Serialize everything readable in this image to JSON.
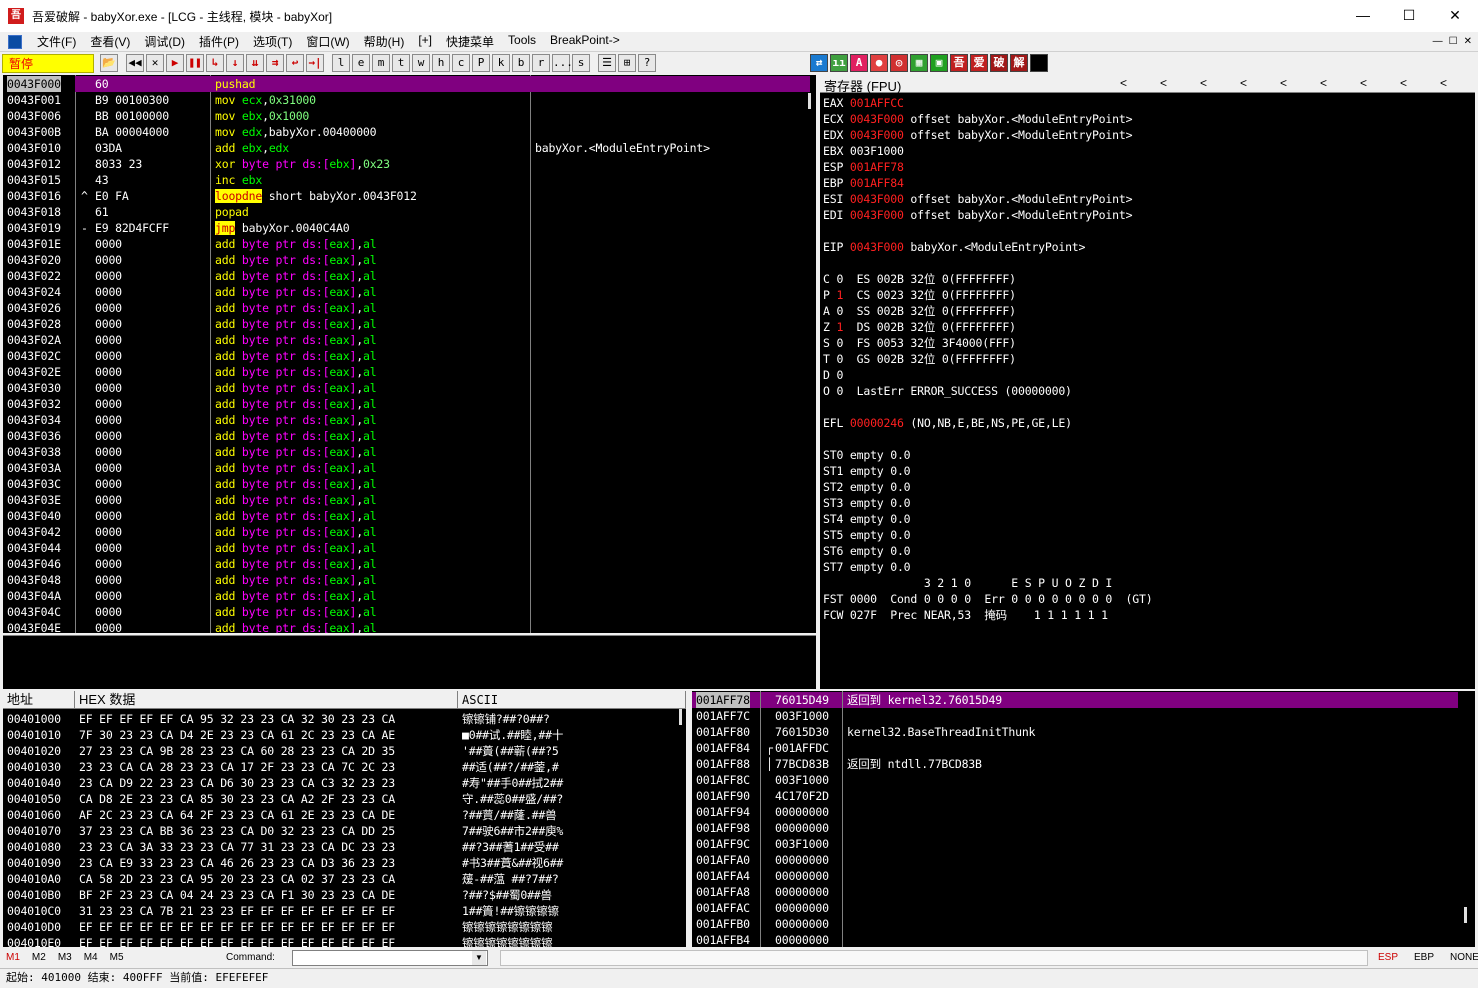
{
  "window": {
    "title": "吾爱破解 - babyXor.exe - [LCG - 主线程, 模块 - babyXor]",
    "app_icon": "吾",
    "minimize": "—",
    "maximize": "☐",
    "close": "✕"
  },
  "menu": [
    "文件(F)",
    "查看(V)",
    "调试(D)",
    "插件(P)",
    "选项(T)",
    "窗口(W)",
    "帮助(H)",
    "[+]",
    "快捷菜单",
    "Tools",
    "BreakPoint->"
  ],
  "mdi_buttons": [
    "—",
    "☐",
    "✕"
  ],
  "toolbar": {
    "status": "暂停",
    "buttons": [
      "📂",
      "◀◀",
      "✕",
      "▶",
      "❚❚",
      "↳",
      "↓",
      "⇊",
      "⇉",
      "↩",
      "→|",
      "l",
      "e",
      "m",
      "t",
      "w",
      "h",
      "c",
      "P",
      "k",
      "b",
      "r",
      "...",
      "s",
      "☰",
      "⊞",
      "?"
    ],
    "right_buttons": [
      {
        "t": "⇄",
        "c": "#1a7ad0"
      },
      {
        "t": "ıı",
        "c": "#40a040"
      },
      {
        "t": "A",
        "c": "#e02060"
      },
      {
        "t": "●",
        "c": "#e04040"
      },
      {
        "t": "◎",
        "c": "#d03030"
      },
      {
        "t": "▦",
        "c": "#30a030"
      },
      {
        "t": "▣",
        "c": "#20a020"
      },
      {
        "t": "吾",
        "c": "#c02020"
      },
      {
        "t": "爱",
        "c": "#c02020"
      },
      {
        "t": "破",
        "c": "#a01818"
      },
      {
        "t": "解",
        "c": "#a01818"
      },
      {
        "t": "",
        "c": "#000000"
      }
    ]
  },
  "disasm": [
    {
      "a": "0043F000",
      "m": "",
      "h": "60",
      "i": [
        [
          "pushad",
          "w"
        ]
      ],
      "c": "",
      "sel": true
    },
    {
      "a": "0043F001",
      "m": "",
      "h": "B9 00100300",
      "i": [
        [
          "mov ",
          "y"
        ],
        [
          "ecx",
          "g"
        ],
        [
          ",",
          "w"
        ],
        [
          "0x31000",
          "n"
        ]
      ],
      "c": ""
    },
    {
      "a": "0043F006",
      "m": "",
      "h": "BB 00100000",
      "i": [
        [
          "mov ",
          "y"
        ],
        [
          "ebx",
          "g"
        ],
        [
          ",",
          "w"
        ],
        [
          "0x1000",
          "n"
        ]
      ],
      "c": ""
    },
    {
      "a": "0043F00B",
      "m": "",
      "h": "BA 00004000",
      "i": [
        [
          "mov ",
          "y"
        ],
        [
          "edx",
          "g"
        ],
        [
          ",babyXor.00400000",
          "w"
        ]
      ],
      "c": ""
    },
    {
      "a": "0043F010",
      "m": "",
      "h": "03DA",
      "i": [
        [
          "add ",
          "y"
        ],
        [
          "ebx",
          "g"
        ],
        [
          ",",
          "w"
        ],
        [
          "edx",
          "g"
        ]
      ],
      "c": "babyXor.<ModuleEntryPoint>"
    },
    {
      "a": "0043F012",
      "m": "",
      "h": "8033 23",
      "i": [
        [
          "xor ",
          "y"
        ],
        [
          "byte ptr ",
          "m"
        ],
        [
          "ds:[",
          "m"
        ],
        [
          "ebx",
          "g"
        ],
        [
          "]",
          "m"
        ],
        [
          ",",
          "w"
        ],
        [
          "0x23",
          "n"
        ]
      ],
      "c": ""
    },
    {
      "a": "0043F015",
      "m": "",
      "h": "43",
      "i": [
        [
          "inc ",
          "y"
        ],
        [
          "ebx",
          "g"
        ]
      ],
      "c": ""
    },
    {
      "a": "0043F016",
      "m": "^",
      "h": "E0 FA",
      "i": [
        [
          "loopdne",
          "hl"
        ],
        [
          " short babyXor.0043F012",
          "w"
        ]
      ],
      "c": ""
    },
    {
      "a": "0043F018",
      "m": "",
      "h": "61",
      "i": [
        [
          "popad",
          "y"
        ]
      ],
      "c": ""
    },
    {
      "a": "0043F019",
      "m": "-",
      "h": "E9 82D4FCFF",
      "i": [
        [
          "jmp",
          "hl"
        ],
        [
          " babyXor.0040C4A0",
          "w"
        ]
      ],
      "c": ""
    },
    {
      "a": "0043F01E",
      "m": "",
      "h": "0000",
      "i": "std",
      "c": ""
    },
    {
      "a": "0043F020",
      "m": "",
      "h": "0000",
      "i": "std",
      "c": ""
    },
    {
      "a": "0043F022",
      "m": "",
      "h": "0000",
      "i": "std",
      "c": ""
    },
    {
      "a": "0043F024",
      "m": "",
      "h": "0000",
      "i": "std",
      "c": ""
    },
    {
      "a": "0043F026",
      "m": "",
      "h": "0000",
      "i": "std",
      "c": ""
    },
    {
      "a": "0043F028",
      "m": "",
      "h": "0000",
      "i": "std",
      "c": ""
    },
    {
      "a": "0043F02A",
      "m": "",
      "h": "0000",
      "i": "std",
      "c": ""
    },
    {
      "a": "0043F02C",
      "m": "",
      "h": "0000",
      "i": "std",
      "c": ""
    },
    {
      "a": "0043F02E",
      "m": "",
      "h": "0000",
      "i": "std",
      "c": ""
    },
    {
      "a": "0043F030",
      "m": "",
      "h": "0000",
      "i": "std",
      "c": ""
    },
    {
      "a": "0043F032",
      "m": "",
      "h": "0000",
      "i": "std",
      "c": ""
    },
    {
      "a": "0043F034",
      "m": "",
      "h": "0000",
      "i": "std",
      "c": ""
    },
    {
      "a": "0043F036",
      "m": "",
      "h": "0000",
      "i": "std",
      "c": ""
    },
    {
      "a": "0043F038",
      "m": "",
      "h": "0000",
      "i": "std",
      "c": ""
    },
    {
      "a": "0043F03A",
      "m": "",
      "h": "0000",
      "i": "std",
      "c": ""
    },
    {
      "a": "0043F03C",
      "m": "",
      "h": "0000",
      "i": "std",
      "c": ""
    },
    {
      "a": "0043F03E",
      "m": "",
      "h": "0000",
      "i": "std",
      "c": ""
    },
    {
      "a": "0043F040",
      "m": "",
      "h": "0000",
      "i": "std",
      "c": ""
    },
    {
      "a": "0043F042",
      "m": "",
      "h": "0000",
      "i": "std",
      "c": ""
    },
    {
      "a": "0043F044",
      "m": "",
      "h": "0000",
      "i": "std",
      "c": ""
    },
    {
      "a": "0043F046",
      "m": "",
      "h": "0000",
      "i": "std",
      "c": ""
    },
    {
      "a": "0043F048",
      "m": "",
      "h": "0000",
      "i": "std",
      "c": ""
    },
    {
      "a": "0043F04A",
      "m": "",
      "h": "0000",
      "i": "std",
      "c": ""
    },
    {
      "a": "0043F04C",
      "m": "",
      "h": "0000",
      "i": "std",
      "c": ""
    },
    {
      "a": "0043F04E",
      "m": "",
      "h": "0000",
      "i": "std",
      "c": ""
    }
  ],
  "std_instr": [
    [
      "add ",
      "y"
    ],
    [
      "byte ptr ",
      "m"
    ],
    [
      "ds:[",
      "m"
    ],
    [
      "eax",
      "g"
    ],
    [
      "]",
      "m"
    ],
    [
      ",",
      "w"
    ],
    [
      "al",
      "g"
    ]
  ],
  "registers": {
    "header": "寄存器 (FPU)",
    "header_arrows": [
      "<",
      "<",
      "<",
      "<",
      "<",
      "<",
      "<",
      "<",
      "<"
    ],
    "lines": [
      [
        [
          "EAX ",
          "w"
        ],
        [
          "001AFFCC",
          "r"
        ]
      ],
      [
        [
          "ECX ",
          "w"
        ],
        [
          "0043F000",
          "r"
        ],
        [
          " offset babyXor.<ModuleEntryPoint>",
          "w"
        ]
      ],
      [
        [
          "EDX ",
          "w"
        ],
        [
          "0043F000",
          "r"
        ],
        [
          " offset babyXor.<ModuleEntryPoint>",
          "w"
        ]
      ],
      [
        [
          "EBX ",
          "w"
        ],
        [
          "003F1000",
          "w"
        ]
      ],
      [
        [
          "ESP ",
          "w"
        ],
        [
          "001AFF78",
          "r"
        ]
      ],
      [
        [
          "EBP ",
          "w"
        ],
        [
          "001AFF84",
          "r"
        ]
      ],
      [
        [
          "ESI ",
          "w"
        ],
        [
          "0043F000",
          "r"
        ],
        [
          " offset babyXor.<ModuleEntryPoint>",
          "w"
        ]
      ],
      [
        [
          "EDI ",
          "w"
        ],
        [
          "0043F000",
          "r"
        ],
        [
          " offset babyXor.<ModuleEntryPoint>",
          "w"
        ]
      ],
      [],
      [
        [
          "EIP ",
          "w"
        ],
        [
          "0043F000",
          "r"
        ],
        [
          " babyXor.<ModuleEntryPoint>",
          "w"
        ]
      ],
      [],
      [
        [
          "C 0  ES 002B 32位 0(FFFFFFFF)",
          "w"
        ]
      ],
      [
        [
          "P ",
          "w"
        ],
        [
          "1",
          "r"
        ],
        [
          "  CS 0023 32位 0(FFFFFFFF)",
          "w"
        ]
      ],
      [
        [
          "A 0  SS 002B 32位 0(FFFFFFFF)",
          "w"
        ]
      ],
      [
        [
          "Z ",
          "w"
        ],
        [
          "1",
          "r"
        ],
        [
          "  DS 002B 32位 0(FFFFFFFF)",
          "w"
        ]
      ],
      [
        [
          "S 0  FS 0053 32位 3F4000(FFF)",
          "w"
        ]
      ],
      [
        [
          "T 0  GS 002B 32位 0(FFFFFFFF)",
          "w"
        ]
      ],
      [
        [
          "D 0",
          "w"
        ]
      ],
      [
        [
          "O 0  LastErr ERROR_SUCCESS (00000000)",
          "w"
        ]
      ],
      [],
      [
        [
          "EFL ",
          "w"
        ],
        [
          "00000246",
          "r"
        ],
        [
          " (NO,NB,E,BE,NS,PE,GE,LE)",
          "w"
        ]
      ],
      [],
      [
        [
          "ST0 empty 0.0",
          "w"
        ]
      ],
      [
        [
          "ST1 empty 0.0",
          "w"
        ]
      ],
      [
        [
          "ST2 empty 0.0",
          "w"
        ]
      ],
      [
        [
          "ST3 empty 0.0",
          "w"
        ]
      ],
      [
        [
          "ST4 empty 0.0",
          "w"
        ]
      ],
      [
        [
          "ST5 empty 0.0",
          "w"
        ]
      ],
      [
        [
          "ST6 empty 0.0",
          "w"
        ]
      ],
      [
        [
          "ST7 empty 0.0",
          "w"
        ]
      ],
      [
        [
          "               3 2 1 0      E S P U O Z D I",
          "w"
        ]
      ],
      [
        [
          "FST 0000  Cond 0 0 0 0  Err 0 0 0 0 0 0 0 0  (GT)",
          "w"
        ]
      ],
      [
        [
          "FCW 027F  Prec NEAR,53  掩码    1 1 1 1 1 1",
          "w"
        ]
      ]
    ]
  },
  "dump": {
    "headers": [
      "地址",
      "HEX 数据",
      "ASCII"
    ],
    "rows": [
      [
        "00401000",
        "EF EF EF EF EF CA 95 32 23 23 CA 32 30 23 23 CA",
        "镲镲铺?##?0##?"
      ],
      [
        "00401010",
        "7F 30 23 23 CA D4 2E 23 23 CA 61 2C 23 23 CA AE",
        "■0##试.##睦,##十"
      ],
      [
        "00401020",
        "27 23 23 CA 9B 28 23 23 CA 60 28 23 23 CA 2D 35",
        "'##蕢(##蕲(##?5"
      ],
      [
        "00401030",
        "23 23 CA CA 28 23 23 CA 17 2F 23 23 CA 7C 2C 23",
        "##适(##?/##蓥,#"
      ],
      [
        "00401040",
        "23 CA D9 22 23 23 CA D6 30 23 23 CA C3 32 23 23",
        "#寿\"##手0##拭2##"
      ],
      [
        "00401050",
        "CA D8 2E 23 23 CA 85 30 23 23 CA A2 2F 23 23 CA",
        "守.##蕊0##盛/##?"
      ],
      [
        "00401060",
        "AF 2C 23 23 CA 64 2F 23 23 CA 61 2E 23 23 CA DE",
        "?##蕒/##蕯.##兽"
      ],
      [
        "00401070",
        "37 23 23 CA BB 36 23 23 CA D0 32 23 23 CA DD 25",
        "7##驶6##市2##庾%"
      ],
      [
        "00401080",
        "23 23 CA 3A 33 23 23 CA 77 31 23 23 CA DC 23 23",
        "##?3##蓍1##受##"
      ],
      [
        "00401090",
        "23 CA E9 33 23 23 CA 46 26 23 23 CA D3 36 23 23",
        "#书3##蕡&##视6##"
      ],
      [
        "004010A0",
        "CA 58 2D 23 23 CA 95 20 23 23 CA 02 37 23 23 CA",
        "蕿-##蕰 ##?7##?"
      ],
      [
        "004010B0",
        "BF 2F 23 23 CA 04 24 23 23 CA F1 30 23 23 CA DE",
        "?##?$##蜀0##兽"
      ],
      [
        "004010C0",
        "31 23 23 CA 7B 21 23 23 EF EF EF EF EF EF EF EF",
        "1##簀!##镲镲镲镲"
      ],
      [
        "004010D0",
        "EF EF EF EF EF EF EF EF EF EF EF EF EF EF EF EF",
        "镲镲镲镲镲镲镲镲"
      ],
      [
        "004010E0",
        "EF EF EF EF EF EF EF EF EF EF EF EF EF EF EF EF",
        "镲镲镲镲镲镲镲镲"
      ]
    ]
  },
  "stack": {
    "rows": [
      {
        "a": "001AFF78",
        "v": "76015D49",
        "c": "返回到 kernel32.76015D49",
        "sel": true,
        "m": ""
      },
      {
        "a": "001AFF7C",
        "v": "003F1000",
        "c": "",
        "m": ""
      },
      {
        "a": "001AFF80",
        "v": "76015D30",
        "c": "kernel32.BaseThreadInitThunk",
        "m": ""
      },
      {
        "a": "001AFF84",
        "v": "001AFFDC",
        "c": "",
        "m": "┌"
      },
      {
        "a": "001AFF88",
        "v": "77BCD83B",
        "c": "返回到 ntdll.77BCD83B",
        "m": "│"
      },
      {
        "a": "001AFF8C",
        "v": "003F1000",
        "c": "",
        "m": ""
      },
      {
        "a": "001AFF90",
        "v": "4C170F2D",
        "c": "",
        "m": ""
      },
      {
        "a": "001AFF94",
        "v": "00000000",
        "c": "",
        "m": ""
      },
      {
        "a": "001AFF98",
        "v": "00000000",
        "c": "",
        "m": ""
      },
      {
        "a": "001AFF9C",
        "v": "003F1000",
        "c": "",
        "m": ""
      },
      {
        "a": "001AFFA0",
        "v": "00000000",
        "c": "",
        "m": ""
      },
      {
        "a": "001AFFA4",
        "v": "00000000",
        "c": "",
        "m": ""
      },
      {
        "a": "001AFFA8",
        "v": "00000000",
        "c": "",
        "m": ""
      },
      {
        "a": "001AFFAC",
        "v": "00000000",
        "c": "",
        "m": ""
      },
      {
        "a": "001AFFB0",
        "v": "00000000",
        "c": "",
        "m": ""
      },
      {
        "a": "001AFFB4",
        "v": "00000000",
        "c": "",
        "m": ""
      }
    ]
  },
  "cmdbar": {
    "tabs": [
      "M1",
      "M2",
      "M3",
      "M4",
      "M5"
    ],
    "label": "Command:",
    "input": "",
    "right": [
      "ESP",
      "EBP",
      "NONE"
    ]
  },
  "status": {
    "text": "起始: 401000 结束: 400FFF 当前值: EFEFEFEF"
  }
}
